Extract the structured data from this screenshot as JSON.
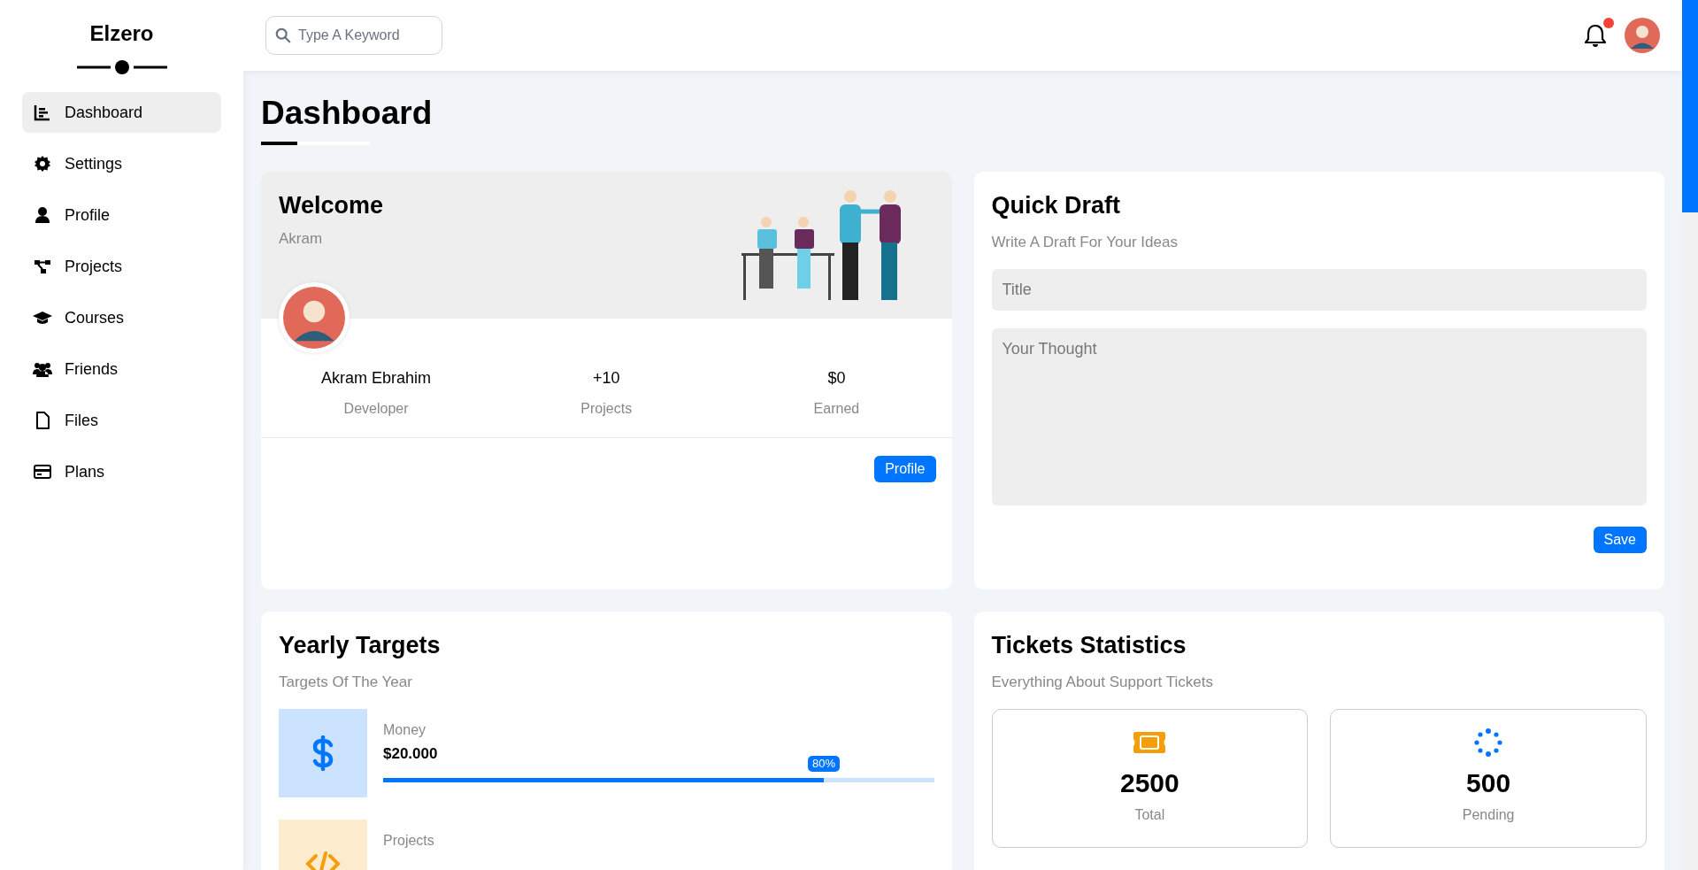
{
  "sidebar": {
    "logo": "Elzero",
    "items": [
      {
        "label": "Dashboard",
        "selected": true
      },
      {
        "label": "Settings",
        "selected": false
      },
      {
        "label": "Profile",
        "selected": false
      },
      {
        "label": "Projects",
        "selected": false
      },
      {
        "label": "Courses",
        "selected": false
      },
      {
        "label": "Friends",
        "selected": false
      },
      {
        "label": "Files",
        "selected": false
      },
      {
        "label": "Plans",
        "selected": false
      }
    ]
  },
  "topbar": {
    "search": {
      "placeholder": "Type A Keyword"
    },
    "notification_unread": true
  },
  "page_title": "Dashboard",
  "welcome": {
    "title": "Welcome",
    "name": "Akram",
    "stats": [
      {
        "value": "Akram Ebrahim",
        "label": "Developer"
      },
      {
        "value": "+10",
        "label": "Projects"
      },
      {
        "value": "$0",
        "label": "Earned"
      }
    ],
    "button": "Profile"
  },
  "quick_draft": {
    "title": "Quick Draft",
    "subtitle": "Write A Draft For Your Ideas",
    "title_field": {
      "placeholder": "Title"
    },
    "thought_field": {
      "placeholder": "Your Thought"
    },
    "button": "Save"
  },
  "yearly_targets": {
    "title": "Yearly Targets",
    "subtitle": "Targets Of The Year",
    "targets": [
      {
        "kind": "money",
        "label": "Money",
        "value": "$20.000",
        "level": 0.8,
        "reading": "80%",
        "color": "#0075ff"
      },
      {
        "kind": "projects",
        "label": "Projects",
        "color": "#f59e0b"
      }
    ]
  },
  "tickets": {
    "title": "Tickets Statistics",
    "subtitle": "Everything About Support Tickets",
    "stats": [
      {
        "kind": "total",
        "value": "2500",
        "label": "Total"
      },
      {
        "kind": "pending",
        "value": "500",
        "label": "Pending"
      }
    ]
  }
}
